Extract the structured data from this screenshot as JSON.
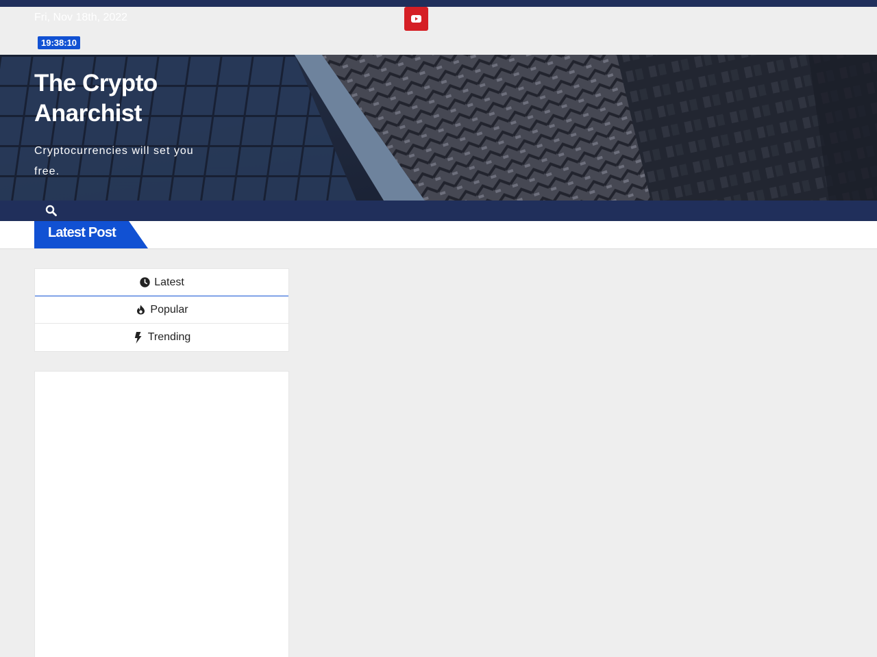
{
  "topbar": {
    "date": "Fri, Nov 18th, 2022",
    "time": "19:38:10"
  },
  "social": {
    "youtube_icon": "youtube-icon"
  },
  "site": {
    "title": "The Crypto Anarchist",
    "tagline": "Cryptocurrencies will set you free."
  },
  "nav": {
    "search_icon": "search-icon"
  },
  "latest": {
    "label": "Latest Post"
  },
  "tabs": [
    {
      "label": "Latest",
      "icon": "clock-icon"
    },
    {
      "label": "Popular",
      "icon": "fire-icon"
    },
    {
      "label": "Trending",
      "icon": "bolt-icon"
    }
  ],
  "colors": {
    "navy": "#202f5b",
    "accent_blue": "#1151d3",
    "youtube_red": "#d51f25",
    "page_bg": "#eeeeee"
  }
}
